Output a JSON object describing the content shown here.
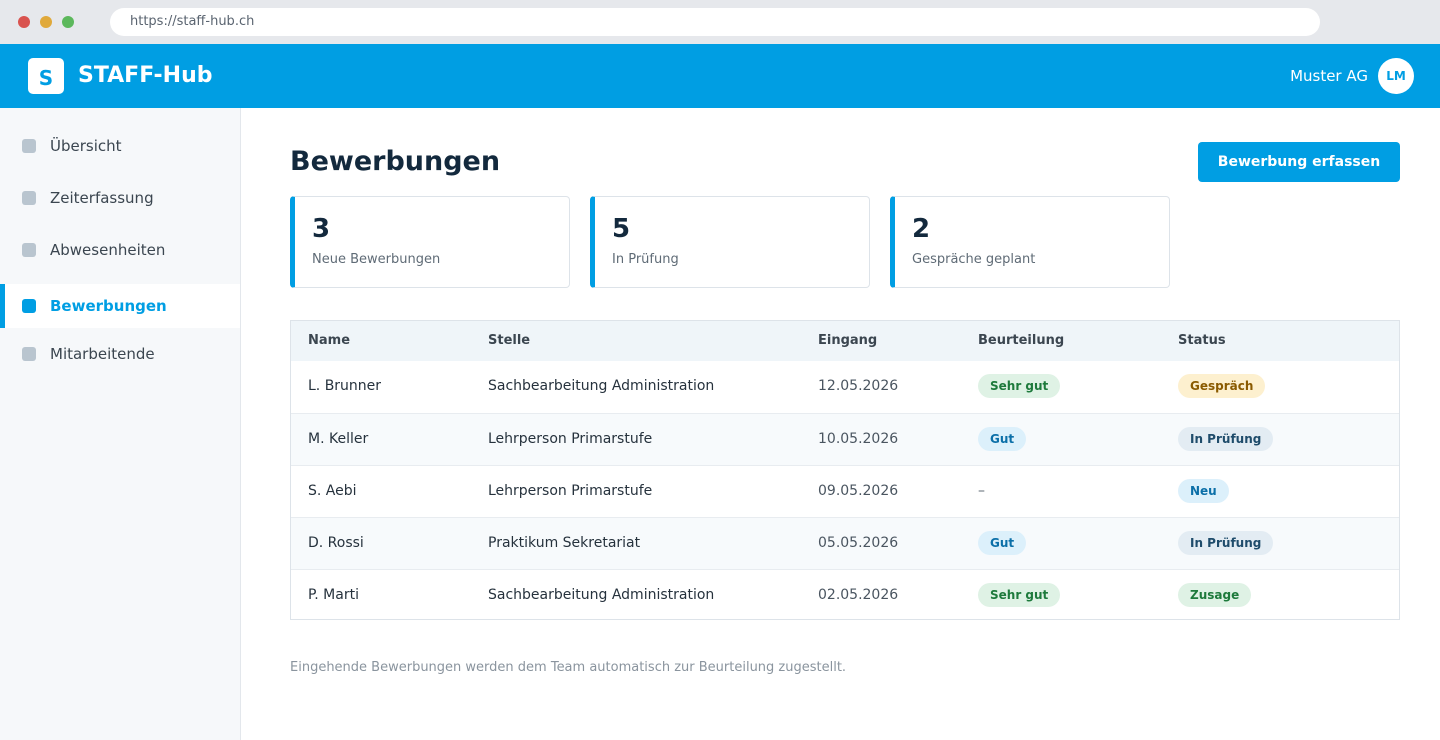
{
  "browser": {
    "url": "https://staff-hub.ch"
  },
  "header": {
    "logo_letter": "S",
    "title": "STAFF-Hub",
    "company": "Muster AG",
    "avatar_initials": "LM"
  },
  "sidebar": {
    "items": [
      {
        "label": "Übersicht",
        "active": false
      },
      {
        "label": "Zeiterfassung",
        "active": false
      },
      {
        "label": "Abwesenheiten",
        "active": false
      },
      {
        "label": "Bewerbungen",
        "active": true
      },
      {
        "label": "Mitarbeitende",
        "active": false
      }
    ]
  },
  "main": {
    "title": "Bewerbungen",
    "primary_button": "Bewerbung erfassen",
    "stats": [
      {
        "value": "3",
        "label": "Neue Bewerbungen"
      },
      {
        "value": "5",
        "label": "In Prüfung"
      },
      {
        "value": "2",
        "label": "Gespräche geplant"
      }
    ],
    "table": {
      "columns": [
        "Name",
        "Stelle",
        "Eingang",
        "Beurteilung",
        "Status"
      ],
      "rows": [
        {
          "name": "L. Brunner",
          "stelle": "Sachbearbeitung Administration",
          "eingang": "12.05.2026",
          "beurteilung": "Sehr gut",
          "status": "Gespräch"
        },
        {
          "name": "M. Keller",
          "stelle": "Lehrperson Primarstufe",
          "eingang": "10.05.2026",
          "beurteilung": "Gut",
          "status": "In Prüfung"
        },
        {
          "name": "S. Aebi",
          "stelle": "Lehrperson Primarstufe",
          "eingang": "09.05.2026",
          "beurteilung": "–",
          "status": "Neu"
        },
        {
          "name": "D. Rossi",
          "stelle": "Praktikum Sekretariat",
          "eingang": "05.05.2026",
          "beurteilung": "Gut",
          "status": "In Prüfung"
        },
        {
          "name": "P. Marti",
          "stelle": "Sachbearbeitung Administration",
          "eingang": "02.05.2026",
          "beurteilung": "Sehr gut",
          "status": "Zusage"
        }
      ]
    },
    "footnote": "Eingehende Bewerbungen werden dem Team automatisch zur Beurteilung zugestellt."
  },
  "colors": {
    "accent": "#009ee3",
    "sidebar_bg": "#f6f8fa",
    "pill_green": "#dff2e5",
    "pill_blue": "#dcf0fb",
    "pill_yellow": "#fdf0cf",
    "pill_grey": "#e3ecf3"
  },
  "icons": {
    "nav_item": "square-icon"
  }
}
